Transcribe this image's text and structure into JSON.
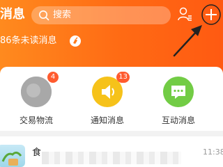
{
  "header": {
    "title": "消息",
    "search_placeholder": "搜索",
    "unread_summary": "86条未读消息",
    "icons": {
      "search": "search-icon",
      "contacts": "person-list-icon",
      "add": "plus-icon",
      "clear_unread": "broom-icon"
    }
  },
  "shortcuts": [
    {
      "label": "交易物流",
      "badge": "4",
      "icon": "package-icon",
      "color": "#a3a3a3"
    },
    {
      "label": "通知消息",
      "badge": "13",
      "icon": "speaker-icon",
      "color": "#f6c21a"
    },
    {
      "label": "互动消息",
      "badge": "",
      "icon": "chat-bubble-icon",
      "color": "#72cc45"
    }
  ],
  "conversations": [
    {
      "title": "食",
      "time": "11:38",
      "avatar": "potted-plant-image"
    }
  ],
  "colors": {
    "header_start": "#ff8a1e",
    "header_end": "#ff5a12",
    "badge": "#ff5b2f"
  }
}
